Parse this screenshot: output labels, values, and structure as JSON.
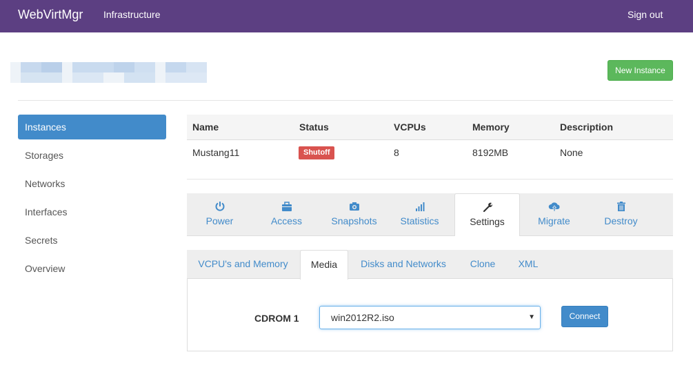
{
  "navbar": {
    "brand": "WebVirtMgr",
    "infrastructure": "Infrastructure",
    "signout": "Sign out",
    "color": "#5c3f82"
  },
  "header": {
    "new_instance": "New Instance"
  },
  "sidebar": {
    "items": [
      {
        "label": "Instances",
        "active": true
      },
      {
        "label": "Storages"
      },
      {
        "label": "Networks"
      },
      {
        "label": "Interfaces"
      },
      {
        "label": "Secrets"
      },
      {
        "label": "Overview"
      }
    ]
  },
  "table": {
    "headers": [
      "Name",
      "Status",
      "VCPUs",
      "Memory",
      "Description"
    ],
    "row": {
      "name": "Mustang11",
      "status": "Shutoff",
      "vcpus": "8",
      "memory": "8192MB",
      "description": "None"
    }
  },
  "actions": [
    {
      "label": "Power",
      "icon": "power-icon"
    },
    {
      "label": "Access",
      "icon": "briefcase-icon"
    },
    {
      "label": "Snapshots",
      "icon": "camera-icon"
    },
    {
      "label": "Statistics",
      "icon": "bar-chart-icon"
    },
    {
      "label": "Settings",
      "icon": "wrench-icon",
      "active": true
    },
    {
      "label": "Migrate",
      "icon": "cloud-upload-icon"
    },
    {
      "label": "Destroy",
      "icon": "trash-icon"
    }
  ],
  "subtabs": [
    {
      "label": "VCPU's and Memory"
    },
    {
      "label": "Media",
      "active": true
    },
    {
      "label": "Disks and Networks"
    },
    {
      "label": "Clone"
    },
    {
      "label": "XML"
    }
  ],
  "media": {
    "cdrom_label": "CDROM 1",
    "selected_iso": "win2012R2.iso",
    "connect": "Connect"
  }
}
